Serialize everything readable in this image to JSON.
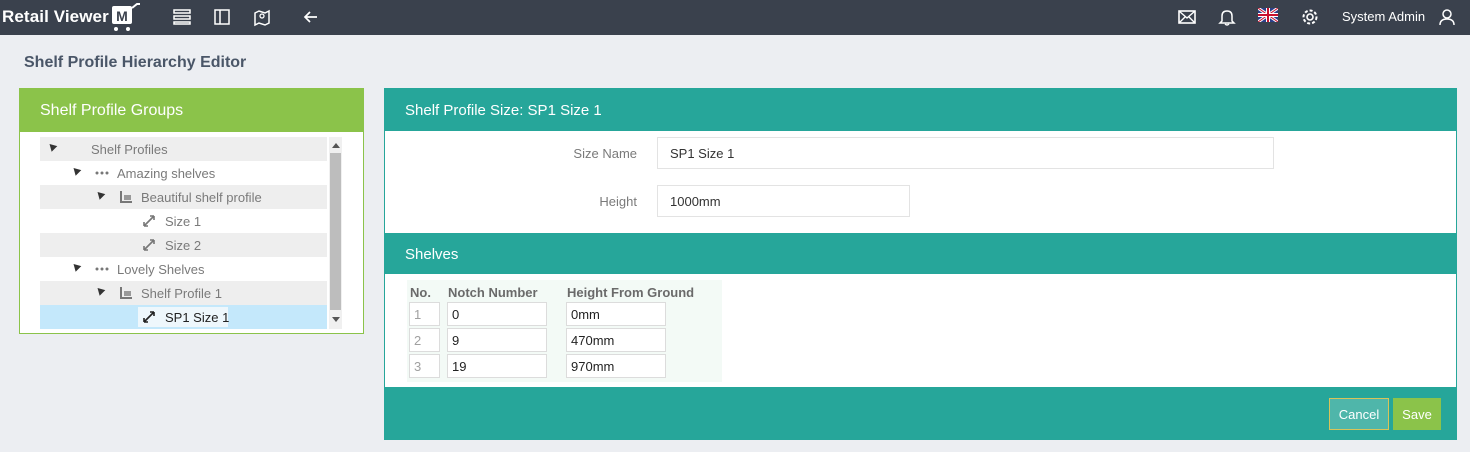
{
  "app": {
    "brand": "Retail Viewer",
    "brand_badge": "M"
  },
  "topbar": {
    "icons": [
      "list-icon",
      "columns-icon",
      "map-icon",
      "back-arrow-icon",
      "mail-icon",
      "bell-icon",
      "uk-flag-icon",
      "gear-icon",
      "user-icon"
    ],
    "user_name": "System Admin"
  },
  "page": {
    "title": "Shelf Profile Hierarchy Editor"
  },
  "groups_panel": {
    "title": "Shelf Profile Groups",
    "tree": [
      {
        "label": "Shelf Profiles",
        "level": 0,
        "icon": "none"
      },
      {
        "label": "Amazing shelves",
        "level": 1,
        "icon": "dots-icon"
      },
      {
        "label": "Beautiful shelf profile",
        "level": 2,
        "icon": "shelf-icon"
      },
      {
        "label": "Size 1",
        "level": 3,
        "icon": "resize-icon"
      },
      {
        "label": "Size 2",
        "level": 3,
        "icon": "resize-icon"
      },
      {
        "label": "Lovely Shelves",
        "level": 1,
        "icon": "dots-icon"
      },
      {
        "label": "Shelf Profile 1",
        "level": 2,
        "icon": "shelf-icon"
      },
      {
        "label": "SP1 Size 1",
        "level": 3,
        "icon": "resize-icon",
        "selected": true
      }
    ]
  },
  "detail_panel": {
    "title": "Shelf Profile Size: SP1 Size 1",
    "size_name_label": "Size Name",
    "size_name_value": "SP1 Size 1",
    "height_label": "Height",
    "height_value": "1000mm"
  },
  "shelves": {
    "title": "Shelves",
    "columns": [
      "No.",
      "Notch Number",
      "Height From Ground"
    ],
    "rows": [
      {
        "no": "1",
        "notch": "0",
        "height": "0mm"
      },
      {
        "no": "2",
        "notch": "9",
        "height": "470mm"
      },
      {
        "no": "3",
        "notch": "19",
        "height": "970mm"
      }
    ]
  },
  "actions": {
    "cancel_label": "Cancel",
    "save_label": "Save"
  },
  "colors": {
    "topbar": "#3a414d",
    "groups_accent": "#8bc34a",
    "detail_accent": "#26a69a",
    "selected_row": "#c4e8fb"
  }
}
